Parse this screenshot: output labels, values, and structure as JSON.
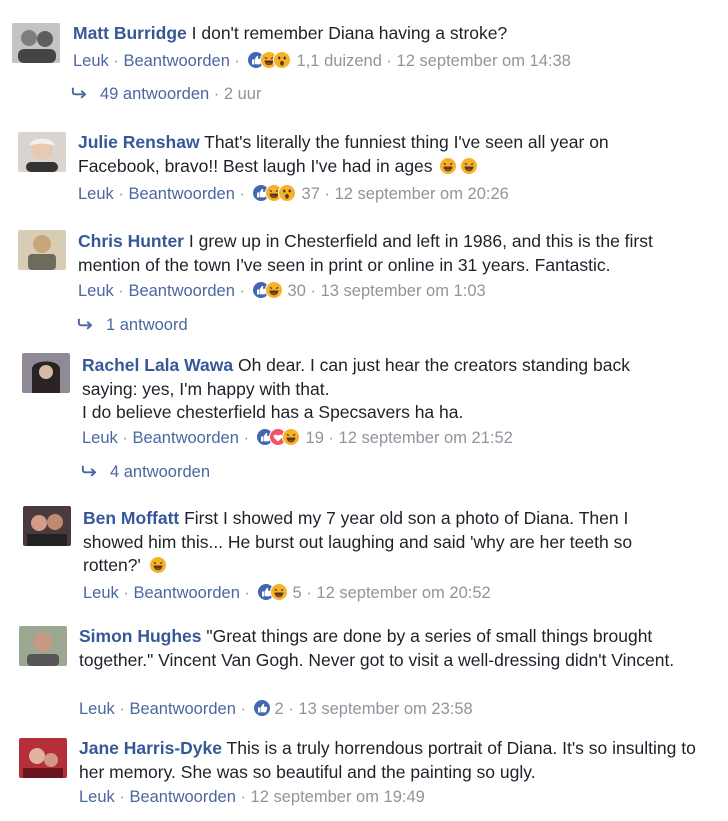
{
  "comments": [
    {
      "author": "Matt Burridge",
      "text": "I don't remember Diana having a stroke?",
      "like": "Leuk",
      "reply": "Beantwoorden",
      "reaction_count": "1,1 duizend",
      "timestamp": "12 september om 14:38",
      "reactions": [
        "like-icon",
        "haha-icon",
        "wow-icon"
      ],
      "replies": "49 antwoorden",
      "replies_time": "2 uur"
    },
    {
      "author": "Julie Renshaw",
      "text": "That's literally the funniest thing I've seen all year on Facebook, bravo!! Best laugh I've had in ages",
      "emoji": "😂😂",
      "like": "Leuk",
      "reply": "Beantwoorden",
      "reaction_count": "37",
      "timestamp": "12 september om 20:26",
      "reactions": [
        "like-icon",
        "haha-icon",
        "wow-icon"
      ]
    },
    {
      "author": "Chris Hunter",
      "text": "I grew up in Chesterfield and left in 1986, and this is the first mention of the town I've seen in print or online in 31 years. Fantastic.",
      "like": "Leuk",
      "reply": "Beantwoorden",
      "reaction_count": "30",
      "timestamp": "13 september om 1:03",
      "reactions": [
        "like-icon",
        "haha-icon"
      ],
      "replies": "1 antwoord"
    },
    {
      "author": "Rachel Lala Wawa",
      "text": "Oh dear. I can just hear the creators standing back saying: yes, I'm happy with that.",
      "text2": "I do believe chesterfield has a Specsavers ha ha.",
      "like": "Leuk",
      "reply": "Beantwoorden",
      "reaction_count": "19",
      "timestamp": "12 september om 21:52",
      "reactions": [
        "like-icon",
        "love-icon",
        "haha-icon"
      ],
      "replies": "4 antwoorden"
    },
    {
      "author": "Ben Moffatt",
      "text": "First I showed my 7 year old son a photo of Diana. Then I showed him this... He burst out laughing and said 'why are her teeth so rotten?'",
      "emoji": "😂",
      "like": "Leuk",
      "reply": "Beantwoorden",
      "reaction_count": "5",
      "timestamp": "12 september om 20:52",
      "reactions": [
        "like-icon",
        "haha-icon"
      ]
    },
    {
      "author": "Simon Hughes",
      "text": "\"Great things are done by a series of small things brought together.\" Vincent Van Gogh. Never got to visit a well-dressing didn't Vincent.",
      "like": "Leuk",
      "reply": "Beantwoorden",
      "reaction_count": "2",
      "timestamp": "13 september om 23:58",
      "reactions": [
        "like-icon"
      ]
    },
    {
      "author": "Jane Harris-Dyke",
      "text": "This is a truly horrendous portrait of Diana. It's so insulting to her memory. She was so beautiful and the painting so ugly.",
      "like": "Leuk",
      "reply": "Beantwoorden",
      "timestamp": "12 september om 19:49"
    }
  ],
  "colors": {
    "link": "#365899",
    "meta": "#90949c",
    "like": "#4267b2",
    "haha": "#f7b125",
    "love": "#f25268"
  }
}
